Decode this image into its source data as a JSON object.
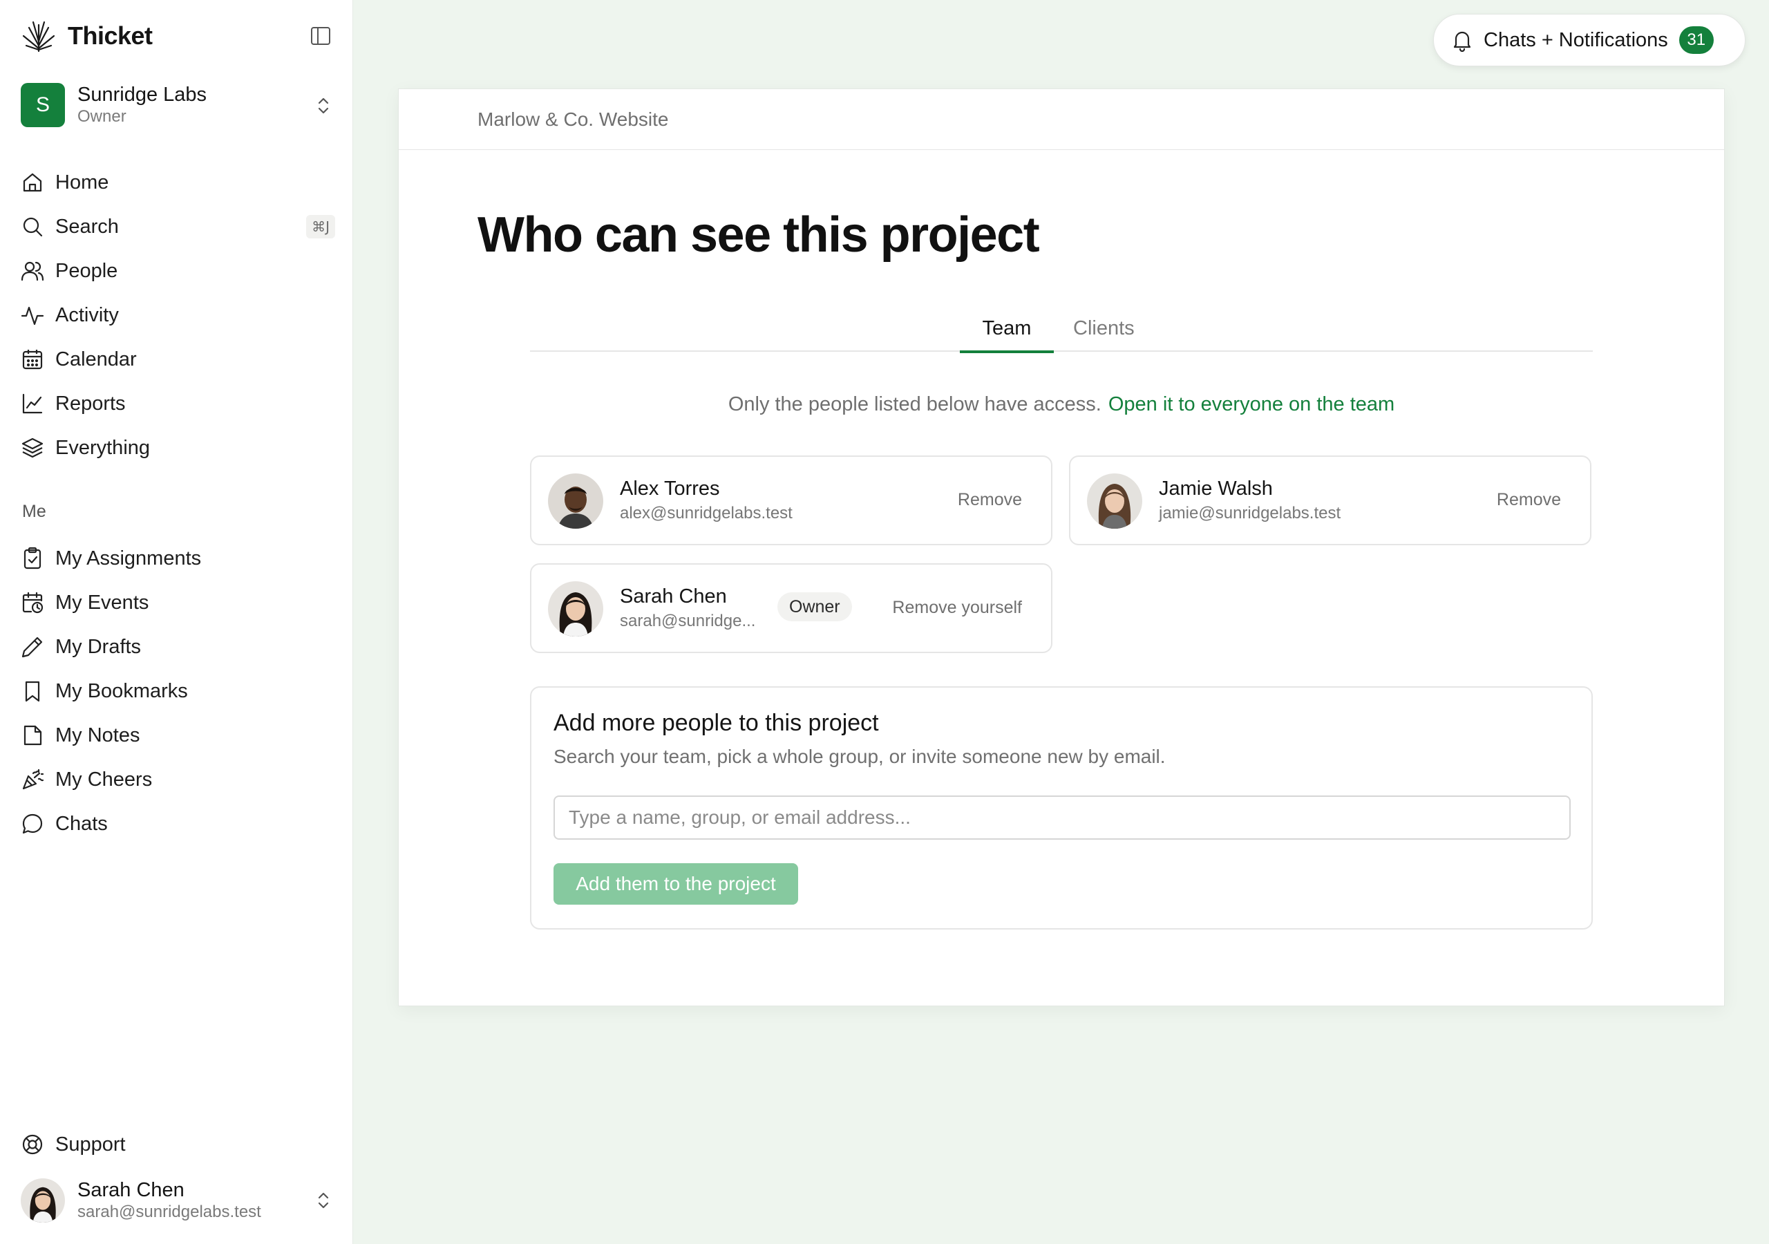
{
  "app": {
    "name": "Thicket"
  },
  "workspace": {
    "name": "Sunridge Labs",
    "role": "Owner",
    "initial": "S"
  },
  "nav_main": [
    {
      "label": "Home",
      "icon": "home-icon"
    },
    {
      "label": "Search",
      "icon": "search-icon",
      "shortcut": "⌘J"
    },
    {
      "label": "People",
      "icon": "people-icon"
    },
    {
      "label": "Activity",
      "icon": "activity-icon"
    },
    {
      "label": "Calendar",
      "icon": "calendar-icon"
    },
    {
      "label": "Reports",
      "icon": "reports-icon"
    },
    {
      "label": "Everything",
      "icon": "layers-icon"
    }
  ],
  "me_section": {
    "label": "Me",
    "items": [
      {
        "label": "My Assignments",
        "icon": "clipboard-icon"
      },
      {
        "label": "My Events",
        "icon": "calendar-clock-icon"
      },
      {
        "label": "My Drafts",
        "icon": "pencil-icon"
      },
      {
        "label": "My Bookmarks",
        "icon": "bookmark-icon"
      },
      {
        "label": "My Notes",
        "icon": "note-icon"
      },
      {
        "label": "My Cheers",
        "icon": "party-popper-icon"
      },
      {
        "label": "Chats",
        "icon": "chat-bubble-icon"
      }
    ]
  },
  "support": {
    "label": "Support",
    "icon": "lifebuoy-icon"
  },
  "current_user": {
    "name": "Sarah Chen",
    "email": "sarah@sunridgelabs.test"
  },
  "notifications": {
    "label": "Chats + Notifications",
    "count": "31"
  },
  "project": {
    "breadcrumb": "Marlow & Co. Website",
    "title": "Who can see this project",
    "tabs": [
      {
        "label": "Team",
        "active": true
      },
      {
        "label": "Clients",
        "active": false
      }
    ],
    "access_note": "Only the people listed below have access.",
    "access_link": "Open it to everyone on the team",
    "members": [
      {
        "name": "Alex Torres",
        "email": "alex@sunridgelabs.test",
        "action": "Remove"
      },
      {
        "name": "Jamie Walsh",
        "email": "jamie@sunridgelabs.test",
        "action": "Remove"
      },
      {
        "name": "Sarah Chen",
        "email": "sarah@sunridge...",
        "badge": "Owner",
        "action": "Remove yourself"
      }
    ],
    "add": {
      "title": "Add more people to this project",
      "subtitle": "Search your team, pick a whole group, or invite someone new by email.",
      "placeholder": "Type a name, group, or email address...",
      "button": "Add them to the project"
    }
  },
  "colors": {
    "accent": "#14803c",
    "accent_disabled": "#86c99f",
    "background": "#eef5ee"
  }
}
